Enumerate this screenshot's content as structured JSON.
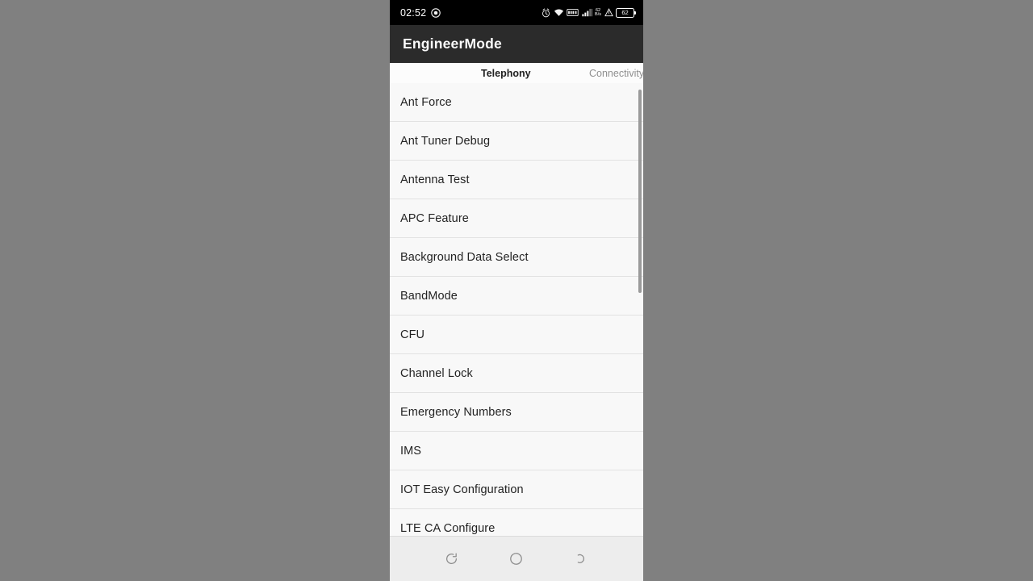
{
  "background": {
    "color": "#808080"
  },
  "status_bar": {
    "time": "02:52",
    "record_icon": "screen-record-icon",
    "icons": [
      "alarm-icon",
      "wifi-icon",
      "vowifi-icon",
      "signal-bars-icon",
      "data-speed-icon",
      "vibrate-icon"
    ],
    "data_speed_top": "62",
    "data_speed_bottom": "B/s",
    "battery_level": "62"
  },
  "app_bar": {
    "title": "EngineerMode"
  },
  "tabs": [
    {
      "label": "",
      "selected": false,
      "name": "tab-previous"
    },
    {
      "label": "Telephony",
      "selected": true,
      "name": "tab-telephony"
    },
    {
      "label": "Connectivity",
      "selected": false,
      "name": "tab-connectivity"
    }
  ],
  "list": {
    "items": [
      {
        "label": "Ant Force"
      },
      {
        "label": "Ant Tuner Debug"
      },
      {
        "label": "Antenna Test"
      },
      {
        "label": "APC Feature"
      },
      {
        "label": "Background Data Select"
      },
      {
        "label": "BandMode"
      },
      {
        "label": "CFU"
      },
      {
        "label": "Channel Lock"
      },
      {
        "label": "Emergency Numbers"
      },
      {
        "label": "IMS"
      },
      {
        "label": "IOT Easy Configuration"
      },
      {
        "label": "LTE CA Configure"
      }
    ]
  },
  "nav_bar": {
    "buttons": [
      {
        "name": "recents-button",
        "icon": "recents-icon"
      },
      {
        "name": "home-button",
        "icon": "home-circle-icon"
      },
      {
        "name": "back-button",
        "icon": "back-arrow-icon"
      }
    ]
  },
  "colors": {
    "app_bar": "#2b2b2b",
    "status_bar": "#000000",
    "list_bg": "#f8f8f8",
    "nav_bar": "#ededed",
    "accent_text": "#212121"
  }
}
